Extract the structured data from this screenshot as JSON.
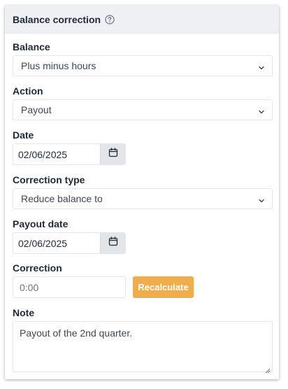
{
  "panel": {
    "title": "Balance correction"
  },
  "fields": {
    "balance": {
      "label": "Balance",
      "value": "Plus minus hours"
    },
    "action": {
      "label": "Action",
      "value": "Payout"
    },
    "date": {
      "label": "Date",
      "value": "02/06/2025"
    },
    "correction_type": {
      "label": "Correction type",
      "value": "Reduce balance to"
    },
    "payout_date": {
      "label": "Payout date",
      "value": "02/06/2025"
    },
    "correction": {
      "label": "Correction",
      "value": "0:00",
      "button_label": "Recalculate"
    },
    "note": {
      "label": "Note",
      "value": "Payout of the 2nd quarter."
    }
  },
  "icons": {
    "help": "question-circle-icon",
    "select_arrow": "chevron-down-icon",
    "calendar": "calendar-icon"
  },
  "colors": {
    "header_bg": "#eef0f4",
    "accent_button": "#f0ad4e",
    "date_button_bg": "#e3e5e8"
  }
}
